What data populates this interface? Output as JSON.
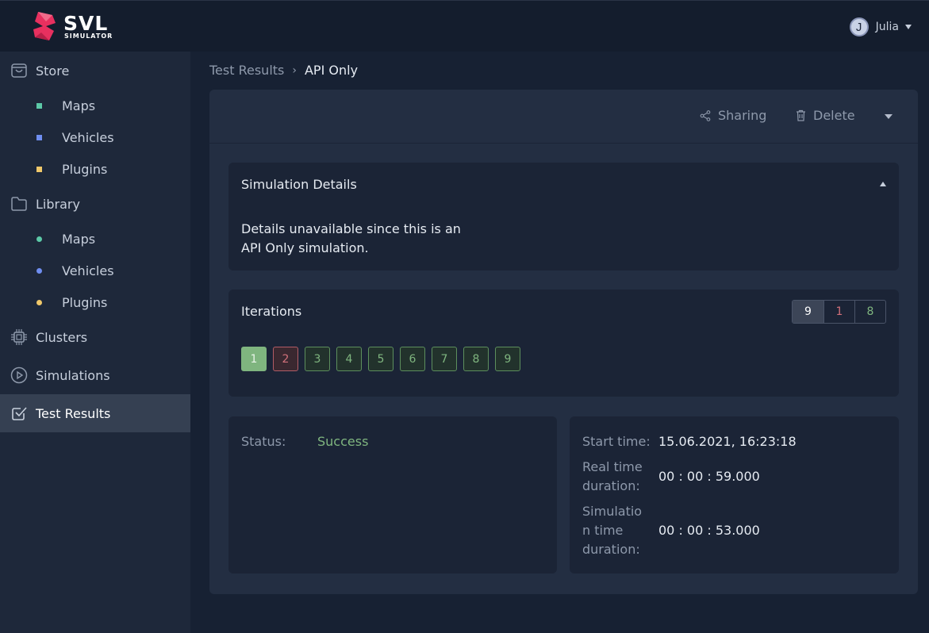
{
  "app": {
    "logo_text": "SVL",
    "logo_subtext": "SIMULATOR",
    "brand_color": "#e8305f"
  },
  "user": {
    "initial": "J",
    "name": "Julia"
  },
  "sidebar": {
    "items": [
      {
        "label": "Store",
        "icon": "bag-icon"
      },
      {
        "label": "Maps",
        "dot_color": "#5cc9a7"
      },
      {
        "label": "Vehicles",
        "dot_color": "#6f8ef0"
      },
      {
        "label": "Plugins",
        "dot_color": "#f0c86a"
      },
      {
        "label": "Library",
        "icon": "folder-icon"
      },
      {
        "label": "Maps",
        "dot_color": "#5cc9a7"
      },
      {
        "label": "Vehicles",
        "dot_color": "#6f8ef0"
      },
      {
        "label": "Plugins",
        "dot_color": "#f0c86a"
      },
      {
        "label": "Clusters",
        "icon": "chip-icon"
      },
      {
        "label": "Simulations",
        "icon": "play-circle-icon"
      },
      {
        "label": "Test Results",
        "icon": "checkbox-icon",
        "active": true
      }
    ]
  },
  "breadcrumb": {
    "parent": "Test Results",
    "separator": "›",
    "current": "API Only"
  },
  "toolbar": {
    "sharing_label": "Sharing",
    "delete_label": "Delete"
  },
  "details": {
    "title": "Simulation Details",
    "text_line1": "Details unavailable since this is an",
    "text_line2": "API Only simulation."
  },
  "iterations": {
    "title": "Iterations",
    "filters": [
      {
        "label": "9",
        "color": "#ffffff"
      },
      {
        "label": "1",
        "color": "#d1707a"
      },
      {
        "label": "8",
        "color": "#7fb57f"
      }
    ],
    "items": [
      {
        "label": "1",
        "state": "selected"
      },
      {
        "label": "2",
        "state": "failed"
      },
      {
        "label": "3",
        "state": "success"
      },
      {
        "label": "4",
        "state": "success"
      },
      {
        "label": "5",
        "state": "success"
      },
      {
        "label": "6",
        "state": "success"
      },
      {
        "label": "7",
        "state": "success"
      },
      {
        "label": "8",
        "state": "success"
      },
      {
        "label": "9",
        "state": "success"
      }
    ]
  },
  "result": {
    "status_label": "Status:",
    "status_value": "Success",
    "start_time_label": "Start time:",
    "start_time_value": "15.06.2021, 16:23:18",
    "real_time_label_1": "Real time",
    "real_time_label_2": "duration:",
    "real_time_value": "00 : 00 : 59.000",
    "sim_time_label_1": "Simulatio",
    "sim_time_label_2": "n time",
    "sim_time_label_3": "duration:",
    "sim_time_value": "00 : 00 : 53.000"
  }
}
